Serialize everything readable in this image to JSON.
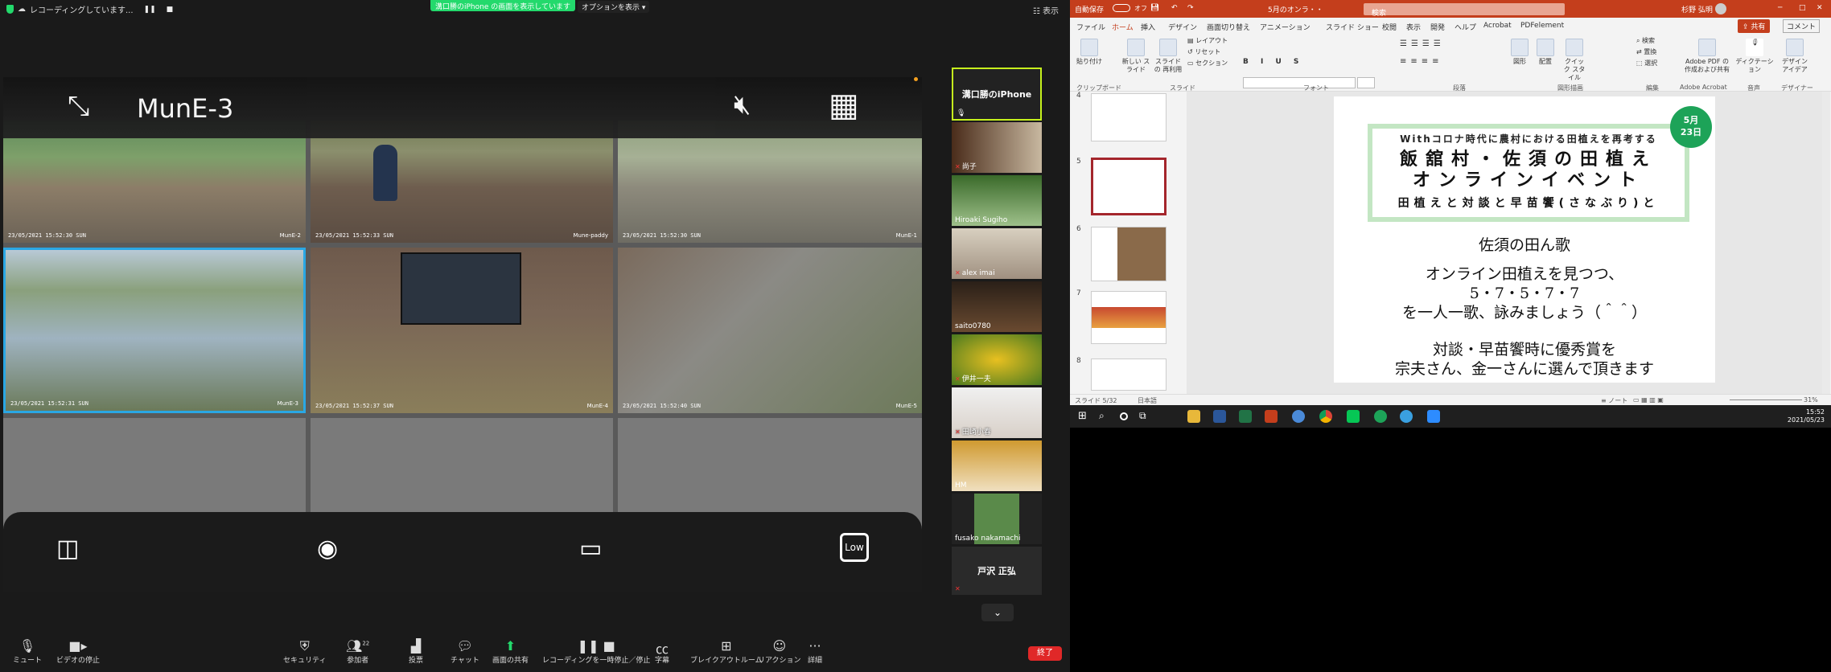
{
  "zoom": {
    "recording_label": "レコーディングしています...",
    "pause_icon": "pause-icon",
    "stop_icon": "stop-icon",
    "viewing_banner": "溝口勝のiPhone の画面を表示しています",
    "options_label": "オプションを表示",
    "view_label": "表示",
    "share_title": "MunE-3",
    "low_label": "Low",
    "cameras": [
      {
        "timestamp": "23/05/2021 15:52:30 SUN",
        "name": "MunE-2"
      },
      {
        "timestamp": "23/05/2021 15:52:33 SUN",
        "name": "Mune-paddy"
      },
      {
        "timestamp": "23/05/2021 15:52:30 SUN",
        "name": "MunE-1"
      },
      {
        "timestamp": "23/05/2021 15:52:31 SUN",
        "name": "MunE-3"
      },
      {
        "timestamp": "23/05/2021 15:52:37 SUN",
        "name": "MunE-4"
      },
      {
        "timestamp": "23/05/2021 15:52:40 SUN",
        "name": "MunE-5"
      }
    ],
    "participants": [
      {
        "name": "溝口勝のiPhone",
        "active": true
      },
      {
        "name": "尚子"
      },
      {
        "name": "Hiroaki Sugiho"
      },
      {
        "name": "alex imai"
      },
      {
        "name": "saito0780"
      },
      {
        "name": "伊井一夫"
      },
      {
        "name": "田崎小春"
      },
      {
        "name": "HM"
      },
      {
        "name": "fusako nakamachi"
      },
      {
        "name": "戸沢 正弘"
      }
    ],
    "toolbar": {
      "mute": "ミュート",
      "video": "ビデオの停止",
      "security": "セキュリティ",
      "participants": "参加者",
      "participants_count": "22",
      "poll": "投票",
      "chat": "チャット",
      "share": "画面の共有",
      "recording": "レコーディングを一時停止／停止",
      "captions": "字幕",
      "breakout": "ブレイクアウトルーム",
      "reaction": "リアクション",
      "more": "詳細",
      "end": "終了"
    }
  },
  "ppt": {
    "autosave": "自動保存",
    "autosave_state": "オフ",
    "filename": "5月のオンラ・・",
    "search_placeholder": "検索",
    "user": "杉野 弘明",
    "tabs": [
      "ファイル",
      "ホーム",
      "挿入",
      "デザイン",
      "画面切り替え",
      "アニメーション",
      "スライド ショー",
      "校閲",
      "表示",
      "開発",
      "ヘルプ",
      "Acrobat",
      "PDFelement"
    ],
    "active_tab": "ホーム",
    "share_label": "共有",
    "comment_label": "コメント",
    "ribbon_groups": [
      "クリップボード",
      "スライド",
      "フォント",
      "段落",
      "図形描画",
      "編集",
      "Adobe Acrobat",
      "音声",
      "デザイナー"
    ],
    "ribbon_buttons": {
      "paste": "貼り付け",
      "new_slide": "新しい スライド",
      "reuse": "スライドの 再利用",
      "layout": "レイアウト",
      "reset": "リセット",
      "section": "セクション",
      "shape": "図形",
      "arrange": "配置",
      "quick_style": "クイック スタイル",
      "find": "検索",
      "replace": "置換",
      "select": "選択",
      "adobe_pdf": "Adobe PDF の 作成および共有",
      "dictate": "ディクテーション",
      "designer": "デザイン アイデア"
    },
    "thumbnail_numbers": [
      "4",
      "5",
      "6",
      "7",
      "8"
    ],
    "selected_slide": "5",
    "slide": {
      "subtitle": "Withコロナ時代に農村における田植えを再考する",
      "title_line1": "飯舘村・佐須の田植え",
      "title_line2": "オンラインイベント",
      "title_line3": "田植えと対談と早苗饗(さなぶり)と",
      "date_month": "5月",
      "date_day": "23日",
      "body": [
        "佐須の田ん歌",
        "オンライン田植えを見つつ、",
        "5・7・5・7・7",
        "を一人一歌、詠みましょう（＾＾）",
        "対談・早苗饗時に優秀賞を",
        "宗夫さん、金一さんに選んで頂きます"
      ]
    },
    "status": {
      "slide_count": "スライド 5/32",
      "language": "日本語",
      "notes": "ノート",
      "zoom": "31%"
    }
  },
  "taskbar": {
    "time": "15:52",
    "date": "2021/05/23"
  },
  "colors": {
    "zoom_green": "#23d96c",
    "ppt_red": "#c43e1c",
    "slide_green": "#1da358",
    "active_tile": "#c6f11d"
  }
}
